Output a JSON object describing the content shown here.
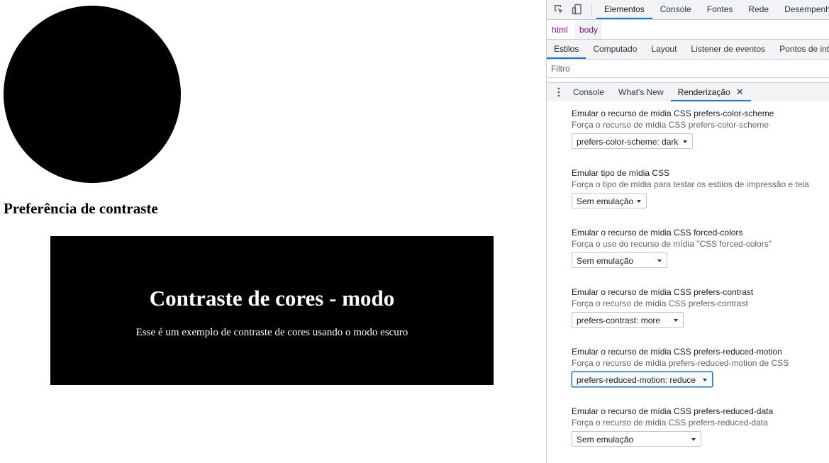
{
  "page": {
    "heading": "Preferência de contraste",
    "box_title": "Contraste de cores - modo",
    "box_text": "Esse é um exemplo de contraste de cores usando o modo escuro"
  },
  "devtools": {
    "main_tabs": [
      "Elementos",
      "Console",
      "Fontes",
      "Rede",
      "Desempenho"
    ],
    "active_main_tab": "Elementos",
    "breadcrumbs": [
      "html",
      "body"
    ],
    "sub_tabs": [
      "Estilos",
      "Computado",
      "Layout",
      "Listener de eventos",
      "Pontos de interrupção"
    ],
    "active_sub_tab": "Estilos",
    "filter_placeholder": "Filtro",
    "drawer_tabs": [
      "Console",
      "What's New",
      "Renderização"
    ],
    "active_drawer_tab": "Renderização",
    "close_symbol": "✕",
    "settings": [
      {
        "title": "Emular o recurso de mídia CSS prefers-color-scheme",
        "desc": "Força o recurso de mídia CSS prefers-color-scheme",
        "value": "prefers-color-scheme: dark"
      },
      {
        "title": "Emular tipo de mídia CSS",
        "desc": "Força o tipo de mídia para testar os estilos de impressão e tela",
        "value": "Sem emulação"
      },
      {
        "title": "Emular o recurso de mídia CSS forced-colors",
        "desc": "Força o uso do recurso de mídia \"CSS forced-colors\"",
        "value": "Sem emulação"
      },
      {
        "title": "Emular o recurso de mídia CSS prefers-contrast",
        "desc": "Força o recurso de mídia CSS prefers-contrast",
        "value": "prefers-contrast: more"
      },
      {
        "title": "Emular o recurso de mídia CSS prefers-reduced-motion",
        "desc": "Força o recurso de mídia prefers-reduced-motion de CSS",
        "value": "prefers-reduced-motion: reduce"
      },
      {
        "title": "Emular o recurso de mídia CSS prefers-reduced-data",
        "desc": "Força o recurso de mídia CSS prefers-reduced-data",
        "value": "Sem emulação"
      }
    ]
  },
  "colors": {
    "accent": "#1a73e8",
    "tag": "#881280",
    "panel_bg": "#f1f3f4"
  }
}
